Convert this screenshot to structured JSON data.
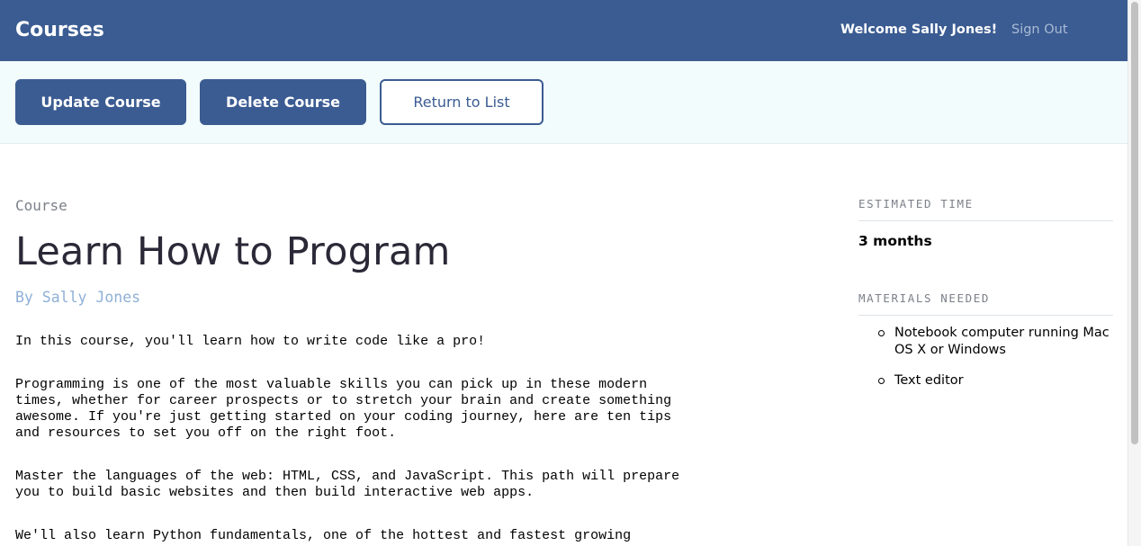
{
  "header": {
    "logo": "Courses",
    "welcome": "Welcome Sally Jones!",
    "sign_out": "Sign Out"
  },
  "actions": {
    "update": "Update Course",
    "delete": "Delete Course",
    "return": "Return to List"
  },
  "course": {
    "label": "Course",
    "title": "Learn How to Program",
    "author": "By Sally Jones",
    "description": [
      "In this course, you'll learn how to write code like a pro!",
      "Programming is one of the most valuable skills you can pick up in these modern\ntimes, whether for career prospects or to stretch your brain and create something\nawesome. If you're just getting started on your coding journey, here are ten tips\nand resources to set you off on the right foot.",
      "Master the languages of the web: HTML, CSS, and JavaScript. This path will prepare\nyou to build basic websites and then build interactive web apps.",
      "We'll also learn Python fundamentals, one of the hottest and fastest growing"
    ]
  },
  "sidebar": {
    "estimated_time_label": "ESTIMATED TIME",
    "estimated_time": "3 months",
    "materials_label": "MATERIALS NEEDED",
    "materials": [
      "Notebook computer running Mac OS X or Windows",
      "Text editor"
    ]
  },
  "colors": {
    "brand": "#3b5c92",
    "actions_bg": "#f2fcfc",
    "author": "#8fb0d6"
  }
}
